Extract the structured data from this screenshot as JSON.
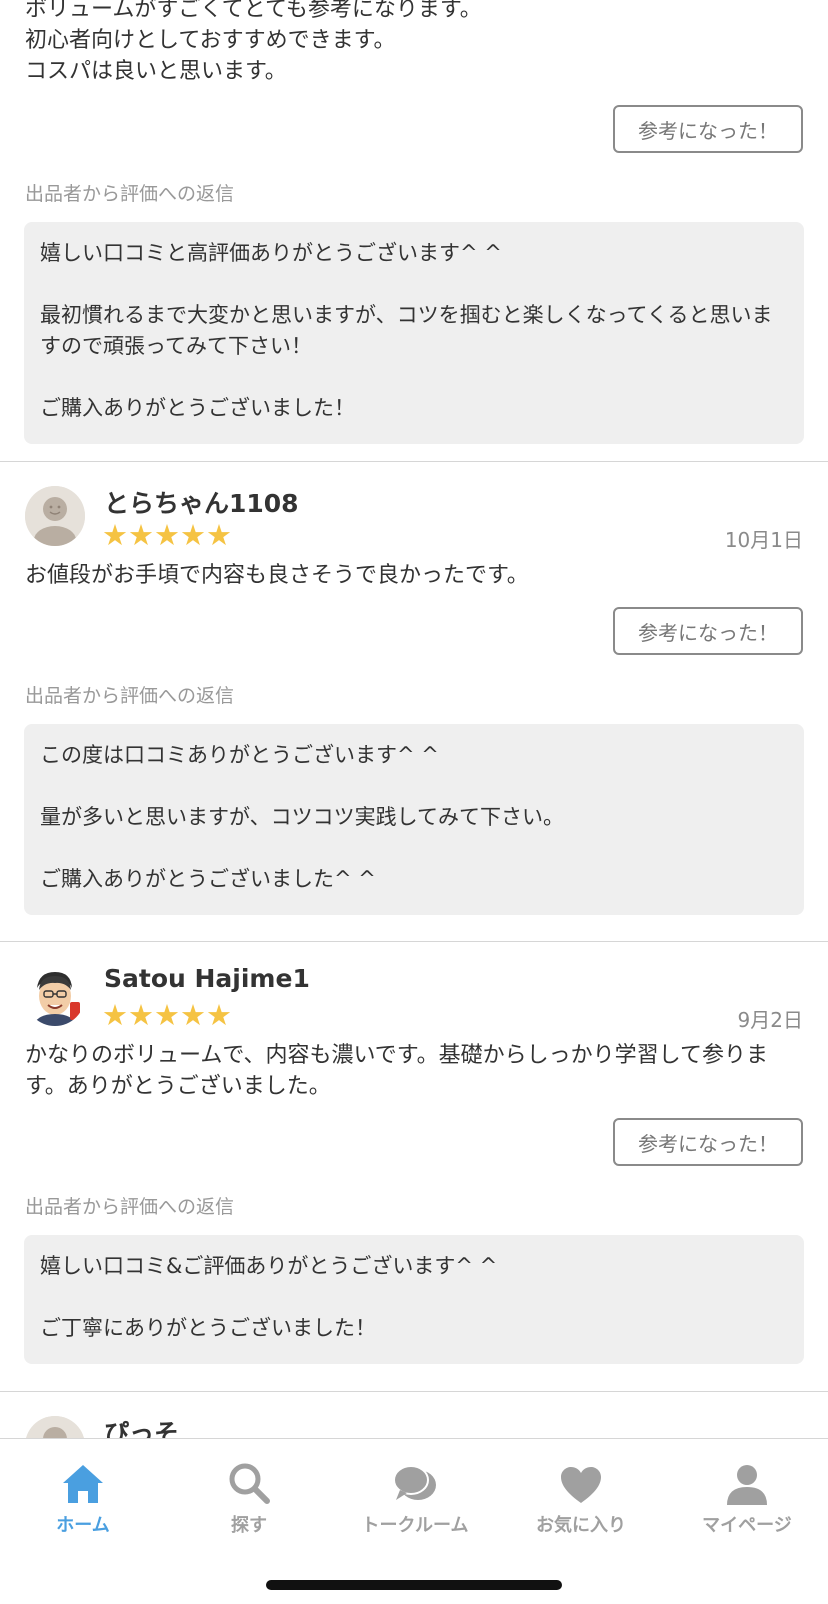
{
  "top_review": {
    "text": "ボリュームがすごくてとても参考になります。\n初心者向けとしておすすめできます。\nコスパは良いと思います。",
    "helpful_label": "参考になった！",
    "reply_label": "出品者から評価への返信",
    "reply_lines": [
      "嬉しい口コミと高評価ありがとうございます^ ^",
      "",
      "最初慣れるまで大変かと思いますが、コツを掴むと楽しくなってくると思いますので頑張ってみて下さい！",
      "",
      "ご購入ありがとうございました！"
    ]
  },
  "reviews": [
    {
      "username": "とらちゃん1108",
      "rating": 5,
      "date": "10月1日",
      "text": "お値段がお手頃で内容も良さそうで良かったです。",
      "helpful_label": "参考になった！",
      "reply_label": "出品者から評価への返信",
      "reply_lines": [
        "この度は口コミありがとうございます^ ^",
        "",
        "量が多いと思いますが、コツコツ実践してみて下さい。",
        "",
        "ご購入ありがとうございました^ ^"
      ]
    },
    {
      "username": "Satou Hajime1",
      "rating": 5,
      "date": "9月2日",
      "text": "かなりのボリュームで、内容も濃いです。基礎からしっかり学習して参ります。ありがとうございました。",
      "helpful_label": "参考になった！",
      "reply_label": "出品者から評価への返信",
      "reply_lines": [
        "嬉しい口コミ&ご評価ありがとうございます^ ^",
        "",
        "ご丁寧にありがとうございました！"
      ]
    }
  ],
  "partial_review": {
    "username": "ぴっそ"
  },
  "stars_glyph": "★★★★★",
  "colors": {
    "star": "#f5c343",
    "accent": "#4a9fe0",
    "reply_bg": "#efefef"
  },
  "tabbar": {
    "tabs": [
      {
        "label": "ホーム",
        "icon": "home-icon",
        "active": true
      },
      {
        "label": "探す",
        "icon": "search-icon",
        "active": false
      },
      {
        "label": "トークルーム",
        "icon": "chat-icon",
        "active": false
      },
      {
        "label": "お気に入り",
        "icon": "heart-icon",
        "active": false
      },
      {
        "label": "マイページ",
        "icon": "person-icon",
        "active": false
      }
    ]
  }
}
